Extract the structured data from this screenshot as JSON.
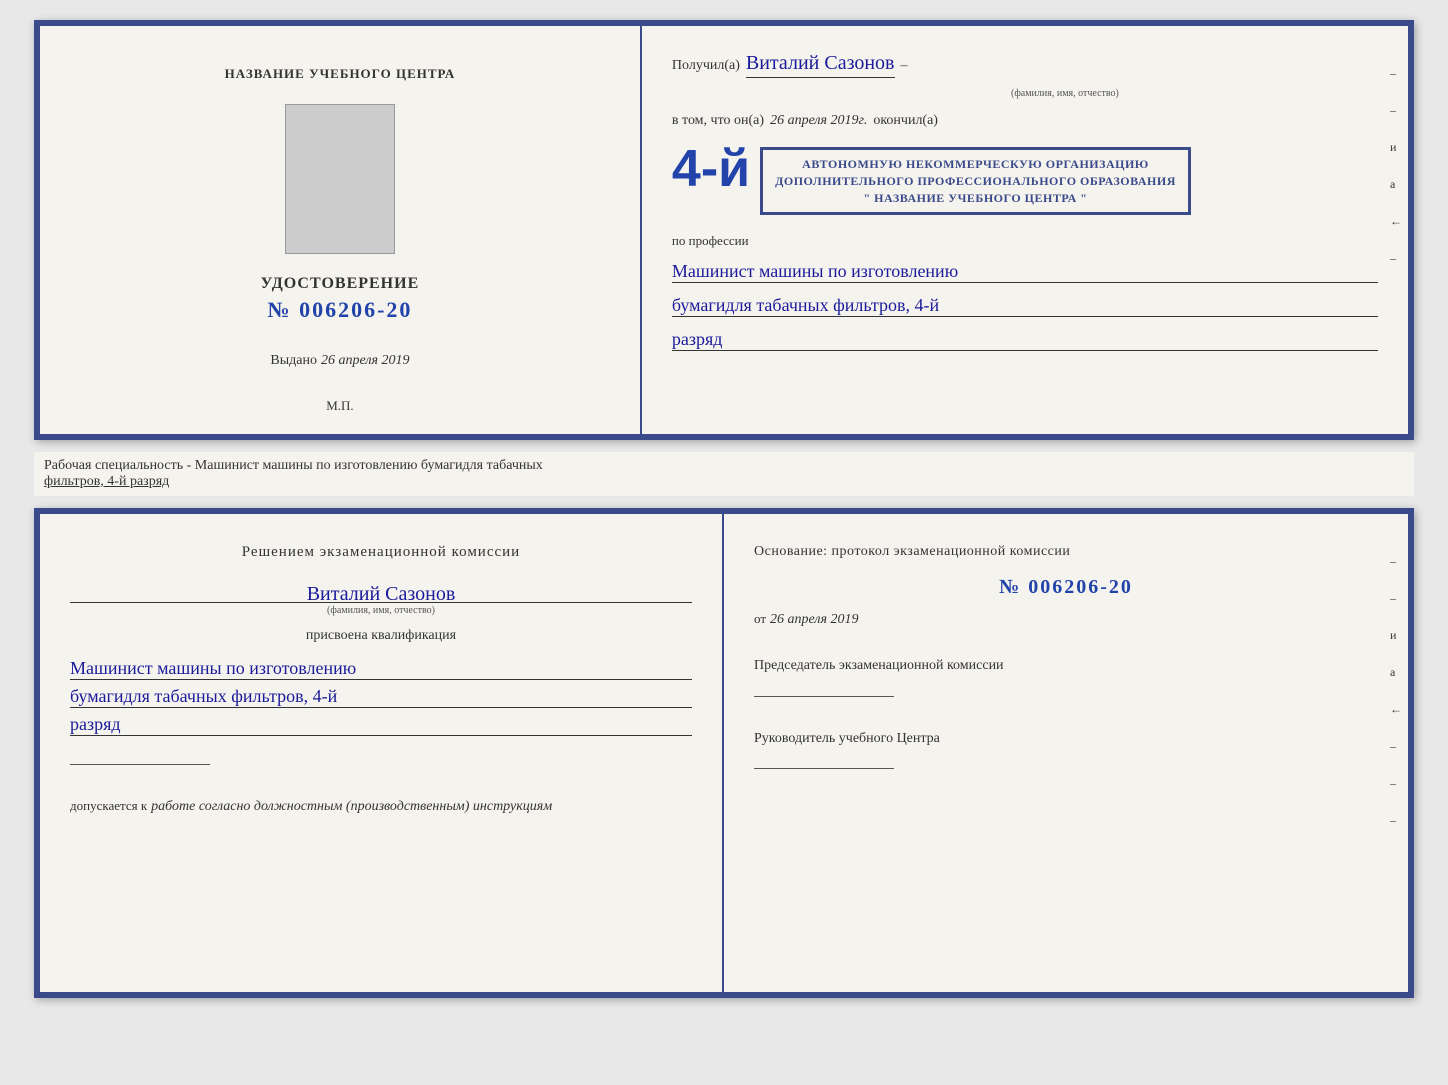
{
  "topDoc": {
    "left": {
      "centerTitle": "НАЗВАНИЕ УЧЕБНОГО ЦЕНТРА",
      "certLabel": "УДОСТОВЕРЕНИЕ",
      "certNumber": "№ 006206-20",
      "issuedLabel": "Выдано",
      "issuedDate": "26 апреля 2019",
      "mpLabel": "М.П."
    },
    "right": {
      "receivedLabel": "Получил(а)",
      "recipientName": "Виталий Сазонов",
      "recipientNote": "(фамилия, имя, отчество)",
      "inFactLabel": "в том, что он(а)",
      "completedDate": "26 апреля 2019г.",
      "completedLabel": "окончил(а)",
      "bigNumber": "4-й",
      "orgLine1": "АВТОНОМНУЮ НЕКОММЕРЧЕСКУЮ ОРГАНИЗАЦИЮ",
      "orgLine2": "ДОПОЛНИТЕЛЬНОГО ПРОФЕССИОНАЛЬНОГО ОБРАЗОВАНИЯ",
      "orgLine3": "\" НАЗВАНИЕ УЧЕБНОГО ЦЕНТРА \"",
      "professionLabel": "по профессии",
      "professionLine1": "Машинист машины по изготовлению",
      "professionLine2": "бумагидля табачных фильтров, 4-й",
      "professionLine3": "разряд"
    }
  },
  "caption": {
    "text": "Рабочая специальность - Машинист машины по изготовлению бумагидля табачных",
    "textUnderlined": "фильтров, 4-й разряд"
  },
  "bottomDoc": {
    "left": {
      "commissionTitle": "Решением экзаменационной комиссии",
      "personName": "Виталий Сазонов",
      "personNote": "(фамилия, имя, отчество)",
      "assignedLabel": "присвоена квалификация",
      "profLine1": "Машинист машины по изготовлению",
      "profLine2": "бумагидля табачных фильтров, 4-й",
      "profLine3": "разряд",
      "admissionLabel": "допускается к",
      "admissionValue": "работе согласно должностным (производственным) инструкциям"
    },
    "right": {
      "basisLabel": "Основание: протокол экзаменационной комиссии",
      "certNumber": "№ 006206-20",
      "fromLabel": "от",
      "fromDate": "26 апреля 2019",
      "chairmanTitle": "Председатель экзаменационной комиссии",
      "directorTitle": "Руководитель учебного Центра"
    },
    "rightMarks": [
      "–",
      "–",
      "и",
      "а",
      "←",
      "–",
      "–",
      "–"
    ]
  }
}
